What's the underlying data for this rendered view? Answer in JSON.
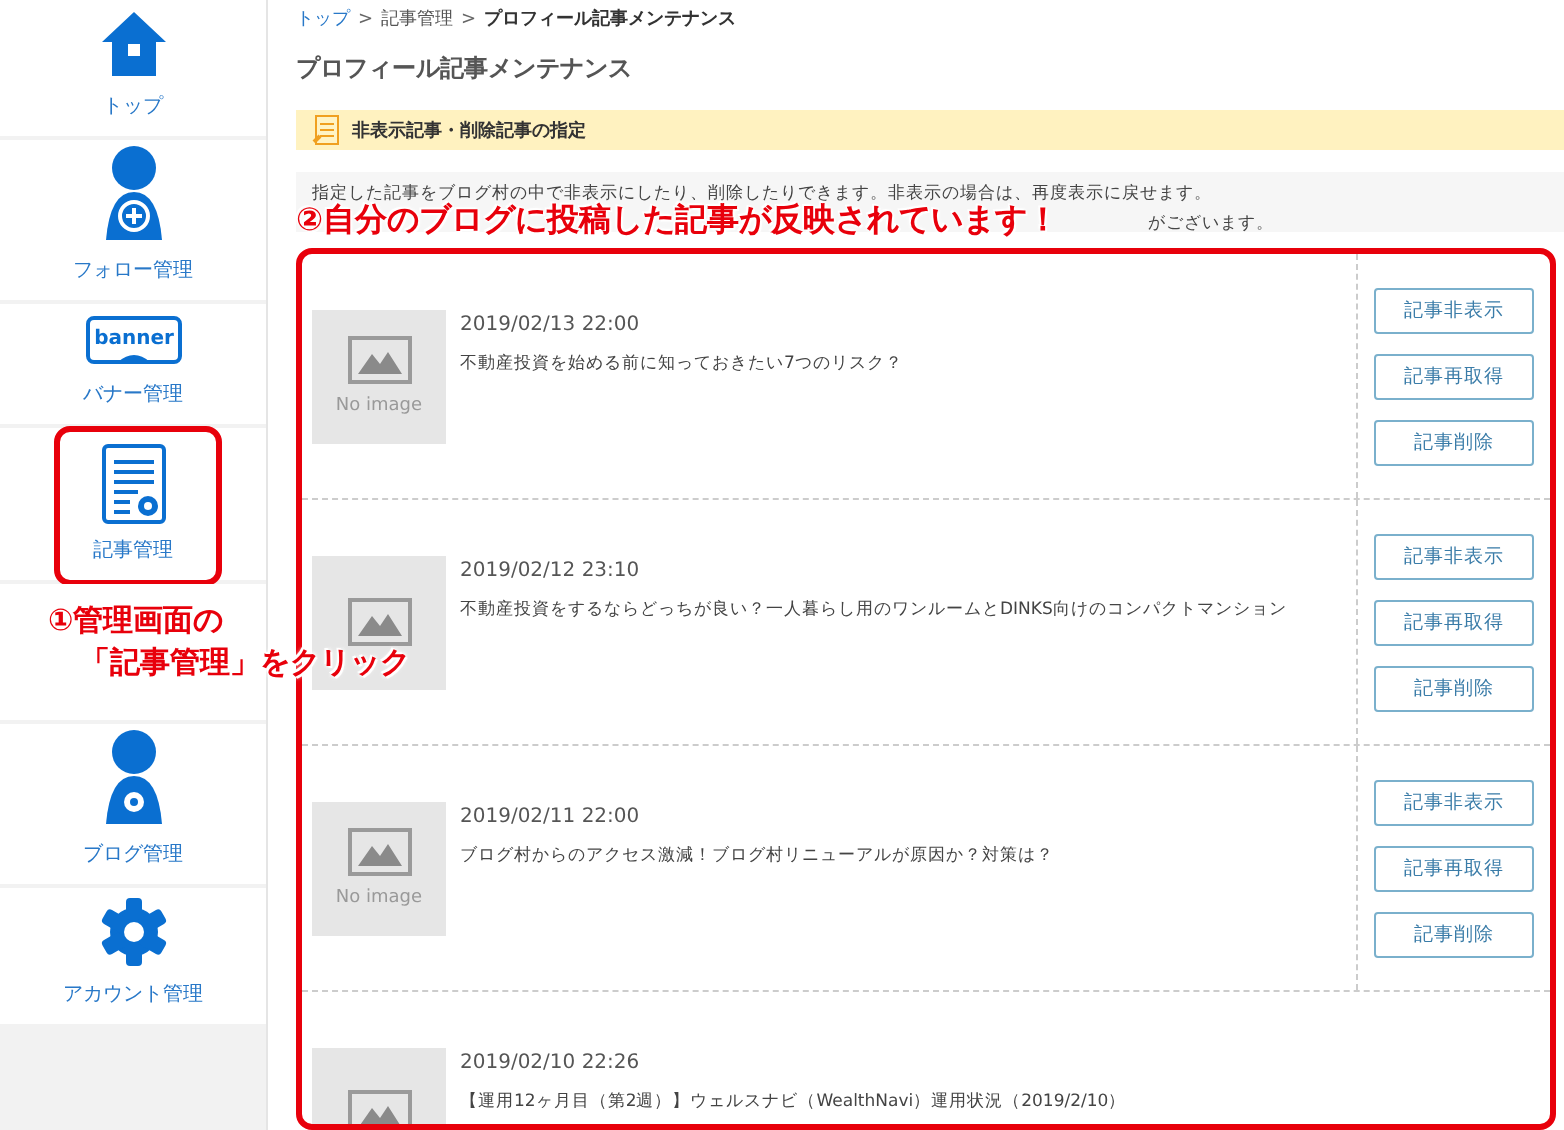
{
  "sidebar": {
    "items": [
      {
        "kind": "home",
        "label": "トップ",
        "circled": false
      },
      {
        "kind": "follow",
        "label": "フォロー管理",
        "circled": false
      },
      {
        "kind": "banner",
        "label": "バナー管理",
        "icon_text": "banner",
        "circled": false
      },
      {
        "kind": "article",
        "label": "記事管理",
        "circled": true
      },
      {
        "kind": "hidden",
        "circled": false
      },
      {
        "kind": "blog",
        "label": "ブログ管理",
        "circled": false
      },
      {
        "kind": "account",
        "label": "アカウント管理",
        "circled": false
      }
    ]
  },
  "breadcrumb_separator": ">",
  "breadcrumb": [
    {
      "label": "トップ",
      "link": true
    },
    {
      "label": "記事管理",
      "link": false
    },
    {
      "label": "プロフィール記事メンテナンス",
      "link": false
    }
  ],
  "page_title": "プロフィール記事メンテナンス",
  "section_heading": "非表示記事・削除記事の指定",
  "info_lines": [
    "指定した記事をブログ村の中で非表示にしたり、削除したりできます。非表示の場合は、再度表示に戻せます。",
    "がございます。"
  ],
  "articles": [
    {
      "thumbnail": "No image",
      "date": "2019/02/13 22:00",
      "title": "不動産投資を始める前に知っておきたい7つのリスク？",
      "buttons": [
        "記事非表示",
        "記事再取得",
        "記事削除"
      ]
    },
    {
      "date": "2019/02/12 23:10",
      "title": "不動産投資をするならどっちが良い？一人暮らし用のワンルームとDINKS向けのコンパクトマンション",
      "buttons": [
        "記事非表示",
        "記事再取得",
        "記事削除"
      ]
    },
    {
      "thumbnail": "No image",
      "date": "2019/02/11 22:00",
      "title": "ブログ村からのアクセス激減！ブログ村リニューアルが原因か？対策は？",
      "buttons": [
        "記事非表示",
        "記事再取得",
        "記事削除"
      ]
    },
    {
      "date": "2019/02/10 22:26",
      "title": "【運用12ヶ月目（第2週）】ウェルスナビ（WealthNavi）運用状況（2019/2/10）"
    }
  ],
  "annotations": [
    {
      "kind": "step1",
      "lines": [
        "①管理画面の",
        "「記事管理」をクリック"
      ]
    },
    {
      "kind": "step2",
      "lines": [
        "②自分のブログに投稿した記事が反映されています！"
      ]
    }
  ]
}
